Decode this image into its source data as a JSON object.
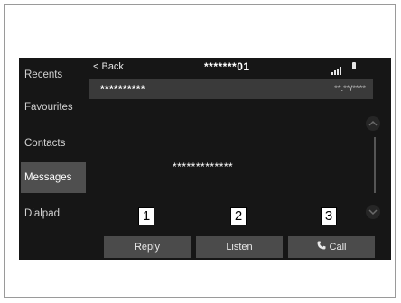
{
  "sidebar": {
    "items": [
      {
        "label": "Recents",
        "active": false
      },
      {
        "label": "Favourites",
        "active": false
      },
      {
        "label": "Contacts",
        "active": false
      },
      {
        "label": "Messages",
        "active": true
      },
      {
        "label": "Dialpad",
        "active": false
      }
    ]
  },
  "topbar": {
    "back_label": "< Back",
    "title": "*******01"
  },
  "message": {
    "sender": "**********",
    "time": "**:**/****",
    "body": "*************"
  },
  "callouts": [
    "1",
    "2",
    "3"
  ],
  "buttons": {
    "reply": "Reply",
    "listen": "Listen",
    "call": "Call"
  },
  "colors": {
    "screen_bg": "#161616",
    "button_bg": "#4b4b4b",
    "active_item_bg": "#4f4f4f",
    "header_bg": "#3a3a3a"
  },
  "icons": [
    "signal-icon",
    "battery-icon",
    "chevron-up-icon",
    "chevron-down-icon",
    "phone-icon"
  ]
}
